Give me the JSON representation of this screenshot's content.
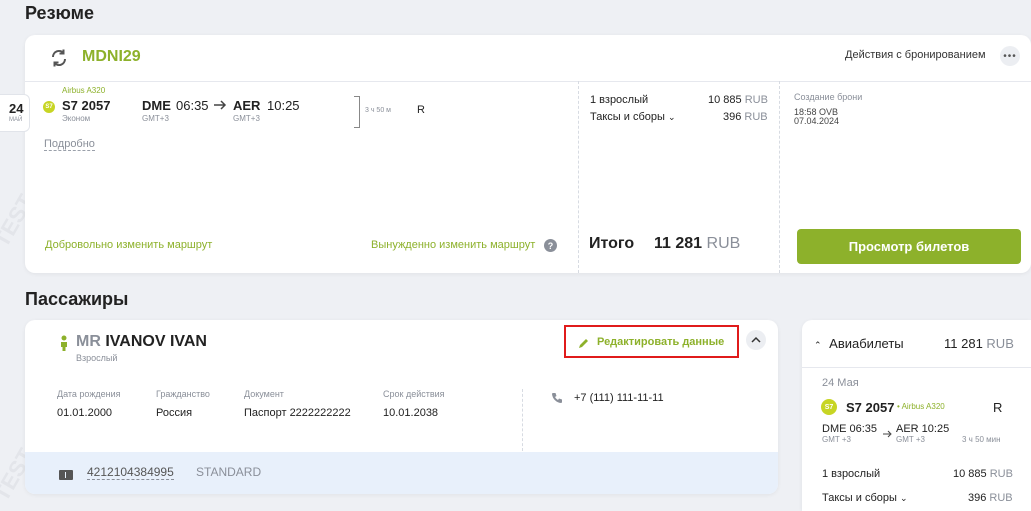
{
  "resume": {
    "title": "Резюме",
    "booking_code": "MDNI29",
    "actions_label": "Действия с бронированием",
    "date_tab": {
      "day": "24",
      "month": "МАЙ"
    },
    "flight": {
      "aircraft": "Airbus A320",
      "airline_logo": "S7",
      "number": "S7 2057",
      "class": "Эконом",
      "from_code": "DME",
      "from_time": "06:35",
      "from_tz": "GMT+3",
      "to_code": "AER",
      "to_time": "10:25",
      "to_tz": "GMT+3",
      "duration": "3 ч 50 м",
      "fare_class": "R"
    },
    "details_link": "Подробно",
    "voluntary_change": "Добровольно изменить маршрут",
    "forced_change": "Вынужденно изменить маршрут",
    "pricing": {
      "adult_label": "1 взрослый",
      "adult_amount": "10 885",
      "currency": "RUB",
      "taxes_label": "Таксы и сборы",
      "taxes_amount": "396",
      "total_label": "Итого",
      "total_amount": "11 281"
    },
    "created": {
      "label": "Создание брони",
      "line1": "18:58 OVB",
      "line2": "07.04.2024"
    },
    "view_tickets": "Просмотр билетов"
  },
  "passengers": {
    "title": "Пассажиры",
    "passenger": {
      "prefix": "MR",
      "name": "IVANOV IVAN",
      "type": "Взрослый",
      "edit_label": "Редактировать данные",
      "fields": [
        {
          "label": "Дата рождения",
          "value": "01.01.2000"
        },
        {
          "label": "Гражданство",
          "value": "Россия"
        },
        {
          "label": "Документ",
          "value": "Паспорт 2222222222"
        },
        {
          "label": "Срок действия",
          "value": "10.01.2038"
        }
      ],
      "phone": "+7 (111) 111-11-11",
      "ticket_number": "4212104384995",
      "ticket_type": "STANDARD"
    }
  },
  "sidebar": {
    "header": "Авиабилеты",
    "total_amount": "11 281",
    "currency": "RUB",
    "date": "24 Мая",
    "airline_logo": "S7",
    "flight_number": "S7 2057",
    "aircraft": "• Airbus A320",
    "fare_class": "R",
    "from": "DME 06:35",
    "from_tz": "GMT +3",
    "to": "AER 10:25",
    "to_tz": "GMT +3",
    "duration": "3 ч 50 мин",
    "adult_label": "1 взрослый",
    "adult_amount": "10 885",
    "taxes_label": "Таксы и сборы",
    "taxes_amount": "396"
  },
  "watermark": "TEST",
  "colors": {
    "accent": "#8db12b",
    "highlight": "#e01b1b",
    "ticket_bar": "#e8f0fb"
  }
}
